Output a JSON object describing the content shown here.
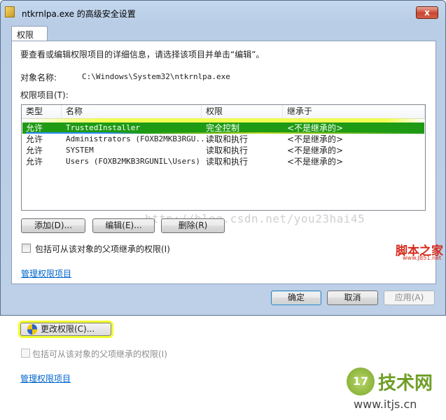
{
  "window": {
    "title": "ntkrnlpa.exe 的高级安全设置",
    "close_label": "x"
  },
  "tab": {
    "label": "权限"
  },
  "instruction": "要查看或编辑权限项目的详细信息，请选择该项目并单击“编辑”。",
  "object": {
    "label": "对象名称:",
    "value": "C:\\Windows\\System32\\ntkrnlpa.exe"
  },
  "permissions": {
    "label": "权限项目(T):",
    "columns": [
      "类型",
      "名称",
      "权限",
      "继承于"
    ],
    "rows": [
      {
        "type": "允许",
        "name": "TrustedInstaller",
        "perm": "完全控制",
        "inherit": "<不是继承的>",
        "selected": true
      },
      {
        "type": "允许",
        "name": "Administrators (FOXB2MKB3RGU...",
        "perm": "读取和执行",
        "inherit": "<不是继承的>"
      },
      {
        "type": "允许",
        "name": "SYSTEM",
        "perm": "读取和执行",
        "inherit": "<不是继承的>"
      },
      {
        "type": "允许",
        "name": "Users (FOXB2MKB3RGUNIL\\Users)",
        "perm": "读取和执行",
        "inherit": "<不是继承的>"
      }
    ]
  },
  "buttons": {
    "add": "添加(D)...",
    "edit": "编辑(E)...",
    "delete": "删除(R)"
  },
  "inherit_checkbox": "包括可从该对象的父项继承的权限(I)",
  "manage_link": "管理权限项目",
  "dialog_buttons": {
    "ok": "确定",
    "cancel": "取消",
    "apply": "应用(A)"
  },
  "watermark": "http://blog.csdn.net/you23hai45",
  "jb51": {
    "logo": "脚本之家",
    "url": "www.JB51.net"
  },
  "lower": {
    "change_permissions": "更改权限(C)...",
    "inherit_checkbox": "包括可从该对象的父项继承的权限(I)",
    "manage_link": "管理权限项目"
  },
  "itjs": {
    "badge": "17",
    "name": "技术网",
    "url": "www.itjs.cn"
  }
}
